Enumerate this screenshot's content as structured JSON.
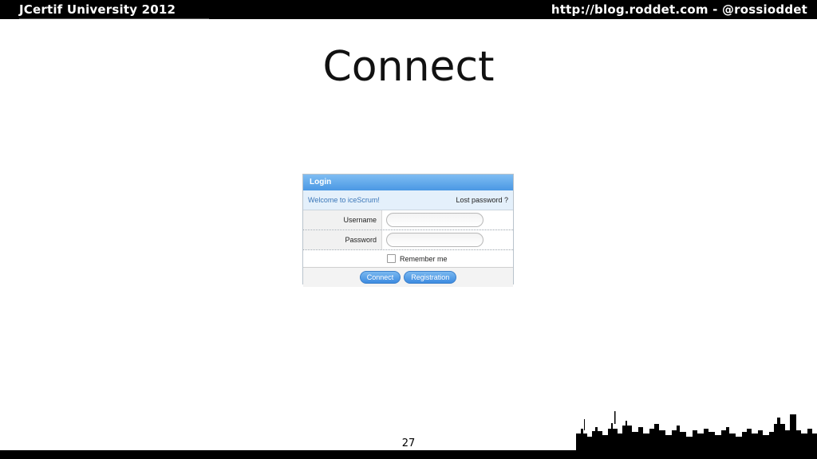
{
  "header": {
    "left_text": "JCertif University 2012",
    "right_text": "http://blog.roddet.com  -  @rossioddet"
  },
  "slide": {
    "title": "Connect",
    "page_number": "27"
  },
  "login": {
    "header": "Login",
    "welcome": "Welcome to iceScrum!",
    "lost_password": "Lost password ?",
    "username_label": "Username",
    "username_value": "",
    "password_label": "Password",
    "password_value": "",
    "remember_label": "Remember me",
    "connect_button": "Connect",
    "registration_button": "Registration"
  },
  "colors": {
    "accent": "#4a98e4",
    "topbar": "#000000"
  }
}
